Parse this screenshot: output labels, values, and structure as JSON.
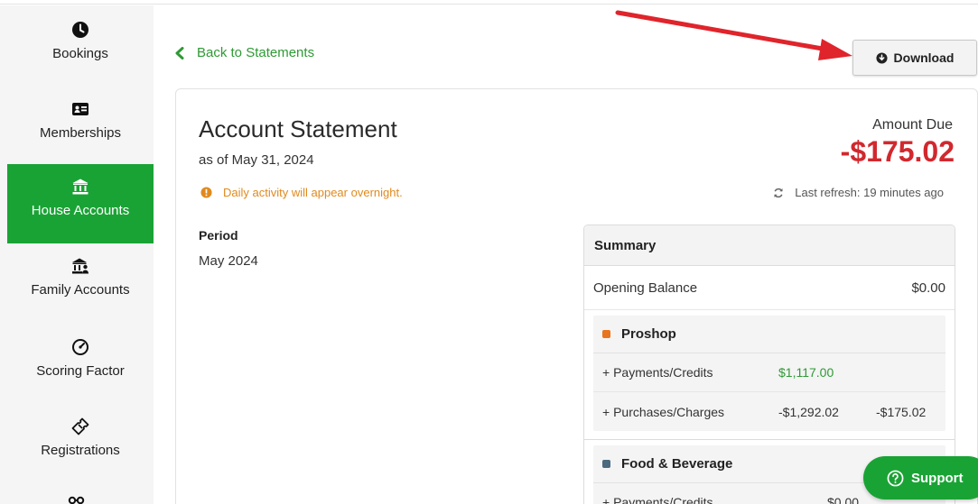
{
  "sidebar": {
    "items": [
      {
        "label": "Bookings",
        "icon": "clock-icon",
        "active": false
      },
      {
        "label": "Memberships",
        "icon": "id-card-icon",
        "active": false
      },
      {
        "label": "House Accounts",
        "icon": "bank-icon",
        "active": true
      },
      {
        "label": "Family Accounts",
        "icon": "family-bank-icon",
        "active": false
      },
      {
        "label": "Scoring Factor",
        "icon": "gauge-icon",
        "active": false
      },
      {
        "label": "Registrations",
        "icon": "ticket-icon",
        "active": false
      }
    ]
  },
  "header": {
    "back_label": "Back to Statements",
    "download_label": "Download"
  },
  "statement": {
    "title": "Account Statement",
    "as_of": "as of May 31, 2024",
    "notice": "Daily activity will appear overnight.",
    "amount_due_label": "Amount Due",
    "amount_due_value": "-$175.02",
    "last_refresh": "Last refresh: 19 minutes ago",
    "period_label": "Period",
    "period_value": "May 2024"
  },
  "summary": {
    "title": "Summary",
    "opening_balance_label": "Opening Balance",
    "opening_balance_value": "$0.00",
    "groups": [
      {
        "name": "Proshop",
        "color": "#e8741e",
        "rows": [
          {
            "label": "+ Payments/Credits",
            "amount": "$1,117.00",
            "total": ""
          },
          {
            "label": "+ Purchases/Charges",
            "amount": "-$1,292.02",
            "total": "-$175.02"
          }
        ]
      },
      {
        "name": "Food & Beverage",
        "color": "#4a6a80",
        "rows": [
          {
            "label": "+ Payments/Credits",
            "amount": "$0.00",
            "total": ""
          }
        ]
      }
    ]
  },
  "support": {
    "label": "Support"
  },
  "colors": {
    "brand_green": "#1aa335",
    "amount_red": "#d1282e",
    "notice_orange": "#e08a1e"
  }
}
